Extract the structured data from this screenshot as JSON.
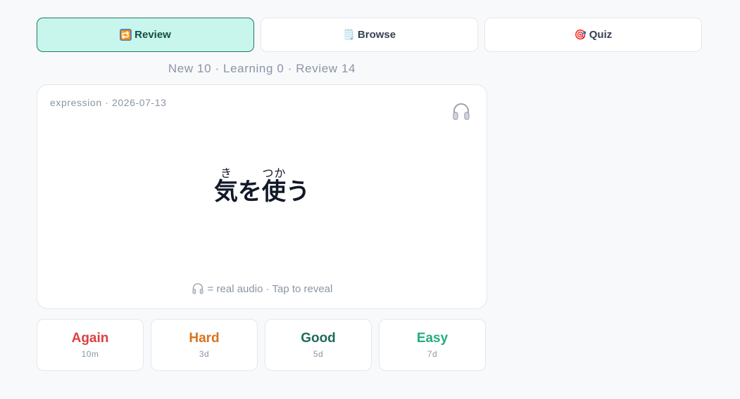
{
  "tabs": [
    {
      "icon": "🔁",
      "icon_name": "repeat-icon",
      "label": "Review",
      "active": true
    },
    {
      "icon": "🗒️",
      "icon_name": "notepad-icon",
      "label": "Browse",
      "active": false
    },
    {
      "icon": "🎯",
      "icon_name": "target-icon",
      "label": "Quiz",
      "active": false
    }
  ],
  "counts": "New 10 · Learning 0 · Review 14",
  "card": {
    "meta": "expression · 2026-07-13",
    "term": {
      "base1": "気",
      "ruby1": "き",
      "kana1": "を",
      "base2": "使",
      "ruby2": "つか",
      "kana2": "う"
    },
    "hint": "= real audio · Tap to reveal"
  },
  "grades": [
    {
      "label": "Again",
      "interval": "10m",
      "color": "#dc3f3f"
    },
    {
      "label": "Hard",
      "interval": "3d",
      "color": "#d9731f"
    },
    {
      "label": "Good",
      "interval": "5d",
      "color": "#1f6b5a"
    },
    {
      "label": "Easy",
      "interval": "7d",
      "color": "#22ad80"
    }
  ]
}
